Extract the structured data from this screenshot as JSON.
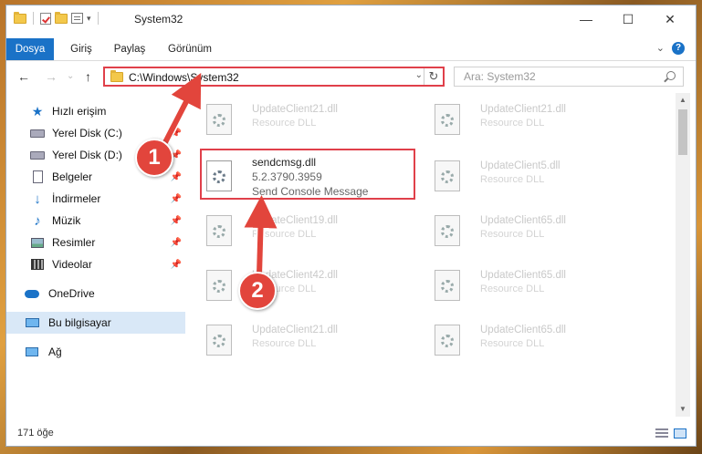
{
  "window": {
    "title": "System32"
  },
  "ribbon": {
    "tabs": [
      "Dosya",
      "Giriş",
      "Paylaş",
      "Görünüm"
    ]
  },
  "address": {
    "path": "C:\\Windows\\System32",
    "search_placeholder": "Ara: System32"
  },
  "sidebar": {
    "items": [
      {
        "label": "Hızlı erişim"
      },
      {
        "label": "Yerel Disk (C:)"
      },
      {
        "label": "Yerel Disk (D:)"
      },
      {
        "label": "Belgeler"
      },
      {
        "label": "İndirmeler"
      },
      {
        "label": "Müzik"
      },
      {
        "label": "Resimler"
      },
      {
        "label": "Videolar"
      },
      {
        "label": "OneDrive"
      },
      {
        "label": "Bu bilgisayar"
      },
      {
        "label": "Ağ"
      }
    ]
  },
  "files": {
    "left": [
      {
        "name": "UpdateClient21.dll",
        "type": "Resource DLL"
      },
      {
        "name": "sendcmsg.dll",
        "version": "5.2.3790.3959",
        "description": "Send Console Message"
      },
      {
        "name": "UpdateClient19.dll",
        "type": "Resource DLL"
      },
      {
        "name": "UpdateClient42.dll",
        "type": "Resource DLL"
      },
      {
        "name": "UpdateClient21.dll",
        "type": "Resource DLL"
      }
    ],
    "right": [
      {
        "name": "UpdateClient21.dll",
        "type": "Resource DLL"
      },
      {
        "name": "UpdateClient5.dll",
        "type": "Resource DLL"
      },
      {
        "name": "UpdateClient65.dll",
        "type": "Resource DLL"
      },
      {
        "name": "UpdateClient65.dll",
        "type": "Resource DLL"
      },
      {
        "name": "UpdateClient65.dll",
        "type": "Resource DLL"
      }
    ]
  },
  "status": {
    "count": "171 öğe"
  },
  "callouts": {
    "one": "1",
    "two": "2"
  },
  "colors": {
    "accent": "#1a72c7",
    "callout": "#e2453c"
  }
}
